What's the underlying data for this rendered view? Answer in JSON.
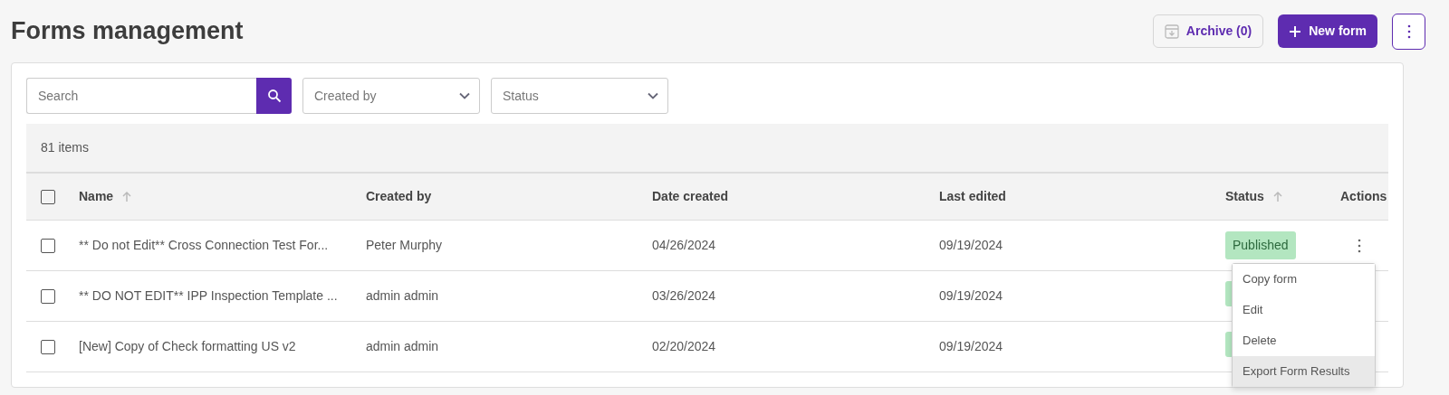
{
  "page": {
    "title": "Forms management"
  },
  "header_buttons": {
    "archive": "Archive (0)",
    "new_form": "New form"
  },
  "filters": {
    "search": {
      "placeholder": "Search"
    },
    "dropdowns": [
      {
        "placeholder": "Created by"
      },
      {
        "placeholder": "Status"
      }
    ]
  },
  "item_count": "81 items",
  "table": {
    "select_all_checked": false,
    "columns": [
      {
        "label": "Name",
        "sortable": true
      },
      {
        "label": "Created by",
        "sortable": false
      },
      {
        "label": "Date created",
        "sortable": false
      },
      {
        "label": "Last edited",
        "sortable": false
      },
      {
        "label": "Status",
        "sortable": true
      },
      {
        "label": "Actions",
        "sortable": false
      }
    ],
    "rows": [
      {
        "checked": false,
        "name": "** Do not Edit** Cross Connection Test For...",
        "created_by": "Peter Murphy",
        "date_created": "04/26/2024",
        "last_edited": "09/19/2024",
        "status": "Published",
        "status_badge": true,
        "actions_menu": true
      },
      {
        "checked": false,
        "name": "** DO NOT EDIT** IPP Inspection Template ...",
        "created_by": "admin admin",
        "date_created": "03/26/2024",
        "last_edited": "09/19/2024",
        "status_badge": true,
        "actions_menu": false
      },
      {
        "checked": false,
        "name": "[New] Copy of Check formatting US v2",
        "created_by": "admin admin",
        "date_created": "02/20/2024",
        "last_edited": "09/19/2024",
        "status_badge": true,
        "actions_menu": false
      }
    ]
  },
  "action_menu": {
    "items": [
      {
        "label": "Copy form",
        "selected": false
      },
      {
        "label": "Edit",
        "selected": false
      },
      {
        "label": "Delete",
        "selected": false
      },
      {
        "label": "Export Form Results",
        "selected": true
      }
    ]
  }
}
